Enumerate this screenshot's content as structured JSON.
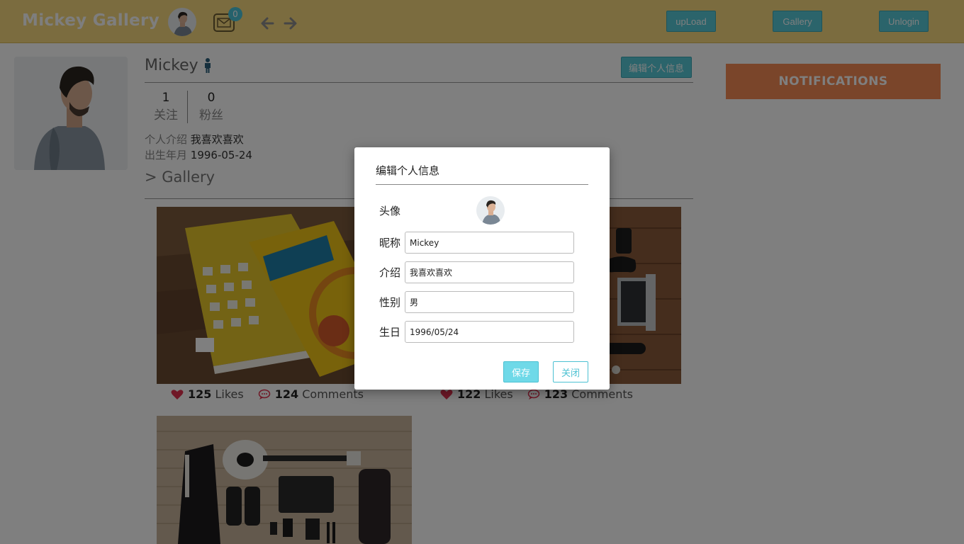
{
  "header": {
    "brand": "Mickey Gallery",
    "mail_count": "0",
    "upload_label": "upLoad",
    "gallery_label": "Gallery",
    "unlogin_label": "Unlogin"
  },
  "profile": {
    "name": "Mickey",
    "edit_label": "编辑个人信息",
    "following_count": "1",
    "following_label": "关注",
    "followers_count": "0",
    "followers_label": "粉丝",
    "intro_label": "个人介绍",
    "intro_value": "我喜欢喜欢",
    "birth_label": "出生年月",
    "birth_value": "1996-05-24",
    "gallery_heading": "> Gallery"
  },
  "posts": [
    {
      "likes": "125",
      "likes_label": "Likes",
      "comments": "124",
      "comments_label": "Comments"
    },
    {
      "likes": "122",
      "likes_label": "Likes",
      "comments": "123",
      "comments_label": "Comments"
    }
  ],
  "notifications": {
    "label": "NOTIFICATIONS"
  },
  "modal": {
    "title": "编辑个人信息",
    "avatar_label": "头像",
    "nickname_label": "昵称",
    "nickname_value": "Mickey",
    "intro_label": "介绍",
    "intro_value": "我喜欢喜欢",
    "gender_label": "性别",
    "gender_value": "男",
    "birthday_label": "生日",
    "birthday_value": "1996/05/24",
    "save_label": "保存",
    "close_label": "关闭"
  },
  "colors": {
    "topbar": "#f7d87e",
    "accent": "#56c8d6",
    "notifications": "#f48a55",
    "like_heart": "#e0304e"
  }
}
